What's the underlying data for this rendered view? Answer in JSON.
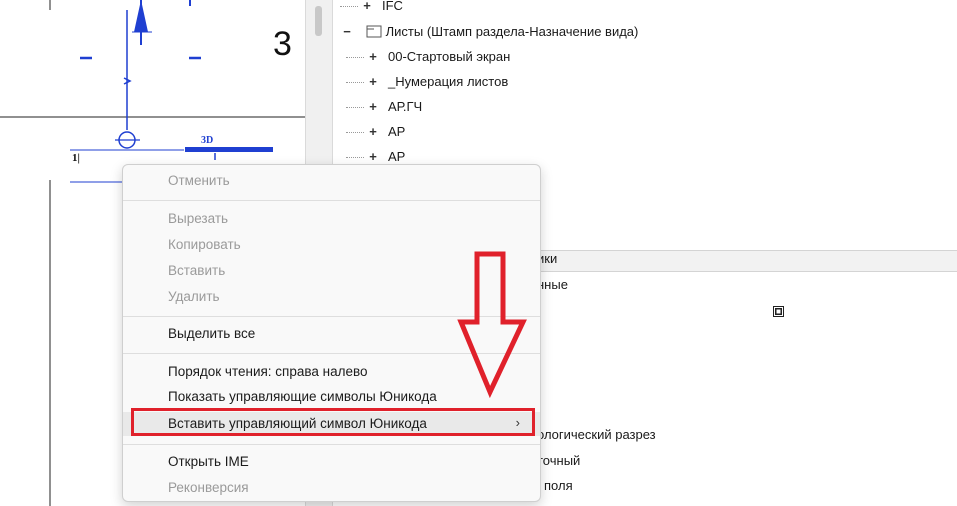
{
  "canvas": {
    "level_number": "3",
    "tag_text": "3D",
    "tag_value": "1",
    "input_value": "1|"
  },
  "tree": {
    "rows": [
      {
        "expander": "+",
        "label": "IFC"
      },
      {
        "expander": "−",
        "label": "Листы (Штамп раздела-Назначение вида)"
      },
      {
        "expander": "+",
        "label": "00-Стартовый экран"
      },
      {
        "expander": "+",
        "label": "_Нумерация листов"
      },
      {
        "expander": "+",
        "label": "АР.ГЧ"
      },
      {
        "expander": "+",
        "label": "АР"
      },
      {
        "expander": "+",
        "label": "АР"
      }
    ]
  },
  "properties": {
    "header_fragment": "ики",
    "row1_fragment": "нные",
    "row2_fragment": "ологический разрез",
    "row3_fragment": "точный",
    "row4_fragment": "поля"
  },
  "context_menu": {
    "items": [
      {
        "label": "Отменить",
        "enabled": false
      },
      {
        "label": "Вырезать",
        "enabled": false
      },
      {
        "label": "Копировать",
        "enabled": false
      },
      {
        "label": "Вставить",
        "enabled": false
      },
      {
        "label": "Удалить",
        "enabled": false
      },
      {
        "label": "Выделить все",
        "enabled": true
      },
      {
        "label": "Порядок чтения: справа налево",
        "enabled": true
      },
      {
        "label": "Показать управляющие символы Юникода",
        "enabled": true
      },
      {
        "label": "Вставить управляющий символ Юникода",
        "enabled": true,
        "submenu_glyph": "›"
      },
      {
        "label": "Открыть IME",
        "enabled": true
      },
      {
        "label": "Реконверсия",
        "enabled": false
      }
    ]
  },
  "colors": {
    "annotation_red": "#e0212b",
    "revit_blue": "#1f3fd1"
  }
}
